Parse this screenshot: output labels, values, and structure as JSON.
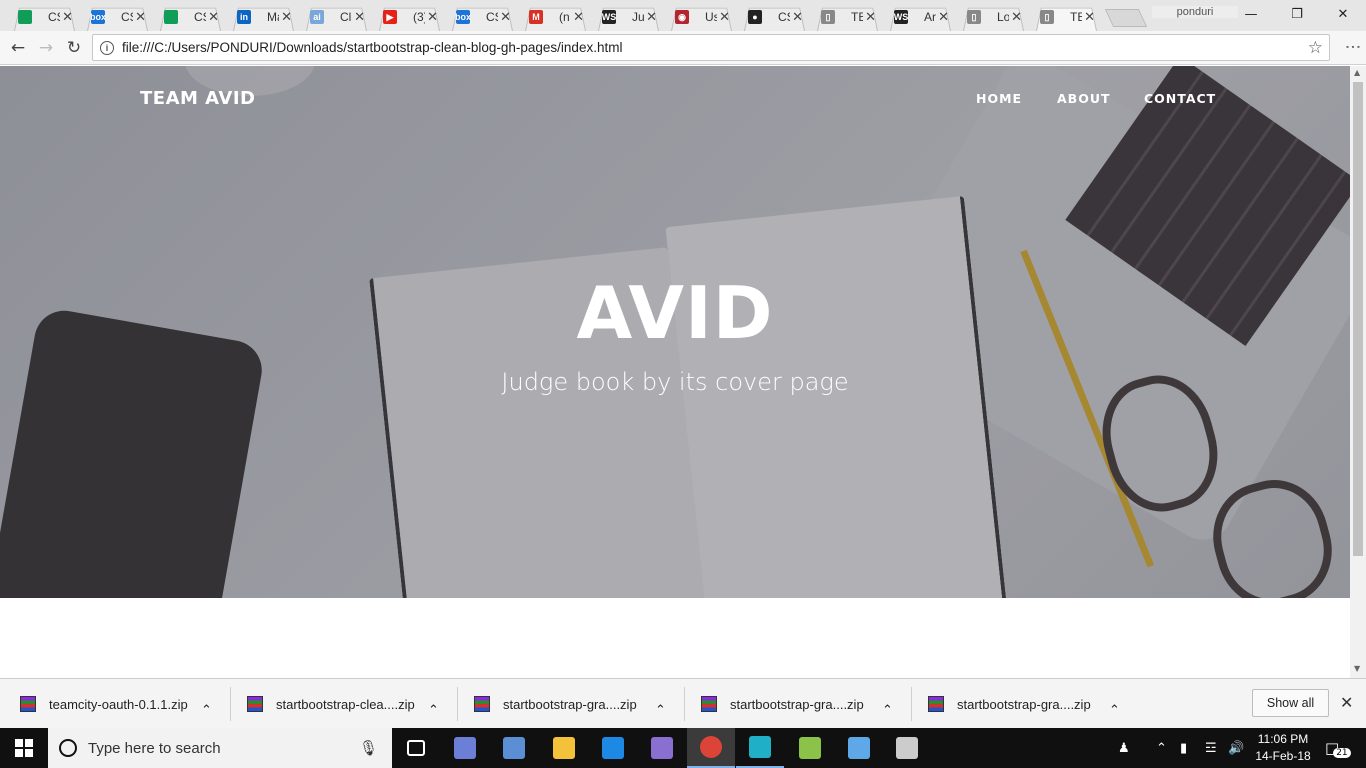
{
  "browser": {
    "tabs": [
      {
        "title": "CS",
        "icon": "sheets-icon",
        "color": "#0f9d58",
        "letter": ""
      },
      {
        "title": "CS",
        "icon": "box-icon",
        "color": "#1e73d6",
        "letter": "box"
      },
      {
        "title": "CS",
        "icon": "sheets-icon",
        "color": "#0f9d58",
        "letter": ""
      },
      {
        "title": "Ma",
        "icon": "linkedin-icon",
        "color": "#0a66c2",
        "letter": "in"
      },
      {
        "title": "Cl",
        "icon": "ai-icon",
        "color": "#7aa7d9",
        "letter": "ai"
      },
      {
        "title": "(3)",
        "icon": "youtube-icon",
        "color": "#e62117",
        "letter": "▶"
      },
      {
        "title": "CS",
        "icon": "box-icon",
        "color": "#1e73d6",
        "letter": "box"
      },
      {
        "title": "(n",
        "icon": "gmail-icon",
        "color": "#d93025",
        "letter": "M"
      },
      {
        "title": "Ju",
        "icon": "webstorm-icon",
        "color": "#222222",
        "letter": "WS"
      },
      {
        "title": "Us",
        "icon": "codeschool-icon",
        "color": "#b4262f",
        "letter": "◉"
      },
      {
        "title": "CS",
        "icon": "github-icon",
        "color": "#222222",
        "letter": "●"
      },
      {
        "title": "TE",
        "icon": "page-icon",
        "color": "#888888",
        "letter": "▯"
      },
      {
        "title": "Ar",
        "icon": "webstorm-icon",
        "color": "#222222",
        "letter": "WS"
      },
      {
        "title": "Lo",
        "icon": "page-icon",
        "color": "#888888",
        "letter": "▯"
      },
      {
        "title": "TE",
        "icon": "page-icon",
        "color": "#888888",
        "letter": "▯"
      }
    ],
    "profile_name": "ponduri",
    "url": "file:///C:/Users/PONDURI/Downloads/startbootstrap-clean-blog-gh-pages/index.html"
  },
  "site": {
    "brand": "TEAM AVID",
    "nav": [
      "HOME",
      "ABOUT",
      "CONTACT"
    ],
    "hero_title": "AVID",
    "hero_subtitle": "Judge book by its cover page"
  },
  "downloads": {
    "items": [
      "teamcity-oauth-0.1.1.zip",
      "startbootstrap-clea....zip",
      "startbootstrap-gra....zip",
      "startbootstrap-gra....zip",
      "startbootstrap-gra....zip"
    ],
    "show_all": "Show all"
  },
  "taskbar": {
    "search_placeholder": "Type here to search",
    "time": "11:06 PM",
    "date": "14-Feb-18",
    "notification_count": "21",
    "apps": [
      {
        "name": "task-view-icon",
        "color": "#ffffff"
      },
      {
        "name": "network-app-icon",
        "color": "#6b7fd7"
      },
      {
        "name": "remote-desktop-icon",
        "color": "#5a8fd6"
      },
      {
        "name": "file-explorer-icon",
        "color": "#f3c13a"
      },
      {
        "name": "edge-icon",
        "color": "#1e88e5"
      },
      {
        "name": "github-desktop-icon",
        "color": "#8a6fd1"
      },
      {
        "name": "chrome-icon",
        "color": "#db4437"
      },
      {
        "name": "webstorm-icon",
        "color": "#1fb0c8"
      },
      {
        "name": "android-studio-icon",
        "color": "#8bc34a"
      },
      {
        "name": "app-box-icon",
        "color": "#5fa8e8"
      },
      {
        "name": "terminal-icon",
        "color": "#cccccc"
      }
    ]
  }
}
